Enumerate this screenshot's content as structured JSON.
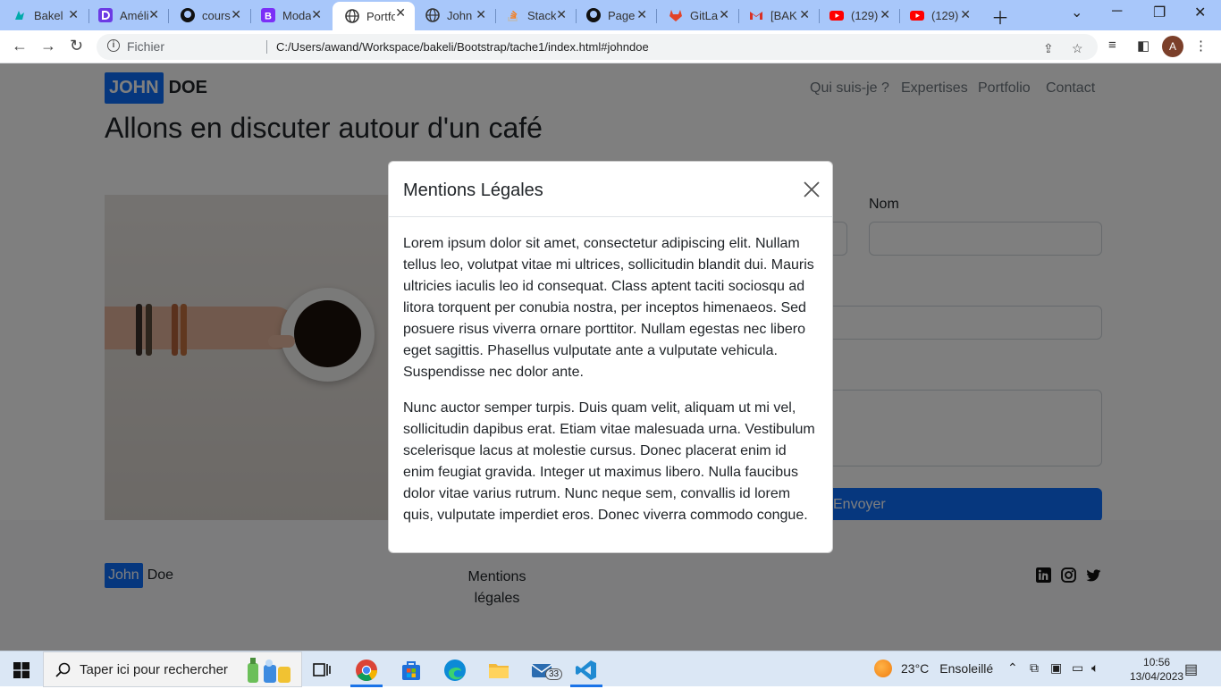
{
  "browser": {
    "tabs": [
      {
        "label": "Bakeli",
        "icon": "bakeli-favicon",
        "active": false
      },
      {
        "label": "Amélie",
        "icon": "dataviz-favicon",
        "active": false
      },
      {
        "label": "cours",
        "icon": "github-favicon",
        "active": false
      },
      {
        "label": "Modal",
        "icon": "bootstrap-favicon",
        "active": false
      },
      {
        "label": "Portfolio",
        "icon": "globe-favicon",
        "active": true
      },
      {
        "label": "John",
        "icon": "globe-favicon",
        "active": false
      },
      {
        "label": "Stack",
        "icon": "stackoverflow-favicon",
        "active": false
      },
      {
        "label": "Page",
        "icon": "github-favicon",
        "active": false
      },
      {
        "label": "GitLab",
        "icon": "gitlab-favicon",
        "active": false
      },
      {
        "label": "[BAK",
        "icon": "gmail-favicon",
        "active": false
      },
      {
        "label": "(129)",
        "icon": "youtube-favicon",
        "active": false
      },
      {
        "label": "(129)",
        "icon": "youtube-favicon",
        "active": false
      }
    ],
    "address": {
      "scheme_label": "Fichier",
      "url": "C:/Users/awand/Workspace/bakeli/Bootstrap/tache1/index.html#johndoe"
    },
    "profile_initial": "A"
  },
  "page": {
    "brand": {
      "part1": "JOHN",
      "part2": "DOE"
    },
    "nav": [
      "Qui suis-je ?",
      "Expertises",
      "Portfolio",
      "Contact"
    ],
    "heading": "Allons en discuter autour d'un café",
    "form": {
      "name_label": "Nom",
      "submit_label": "Envoyer"
    },
    "footer": {
      "brand_part1": "John",
      "brand_part2": "Doe",
      "legal_link": "Mentions légales"
    }
  },
  "modal": {
    "title": "Mentions Légales",
    "paragraphs": [
      "Lorem ipsum dolor sit amet, consectetur adipiscing elit. Nullam tellus leo, volutpat vitae mi ultrices, sollicitudin blandit dui. Mauris ultricies iaculis leo id consequat. Class aptent taciti sociosqu ad litora torquent per conubia nostra, per inceptos himenaeos. Sed posuere risus viverra ornare porttitor. Nullam egestas nec libero eget sagittis. Phasellus vulputate ante a vulputate vehicula. Suspendisse nec dolor ante.",
      "Nunc auctor semper turpis. Duis quam velit, aliquam ut mi vel, sollicitudin dapibus erat. Etiam vitae malesuada urna. Vestibulum scelerisque lacus at molestie cursus. Donec placerat enim id enim feugiat gravida. Integer ut maximus libero. Nulla faucibus dolor vitae varius rutrum. Nunc neque sem, convallis id lorem quis, vulputate imperdiet eros. Donec viverra commodo congue."
    ]
  },
  "taskbar": {
    "search_placeholder": "Taper ici pour rechercher",
    "mail_badge": "33",
    "weather": {
      "temp": "23°C",
      "condition": "Ensoleillé"
    },
    "time": "10:56",
    "date": "13/04/2023"
  },
  "colors": {
    "primary": "#0d6efd",
    "tabstrip": "#a8c7fa",
    "taskbar": "#dbe7f5"
  }
}
